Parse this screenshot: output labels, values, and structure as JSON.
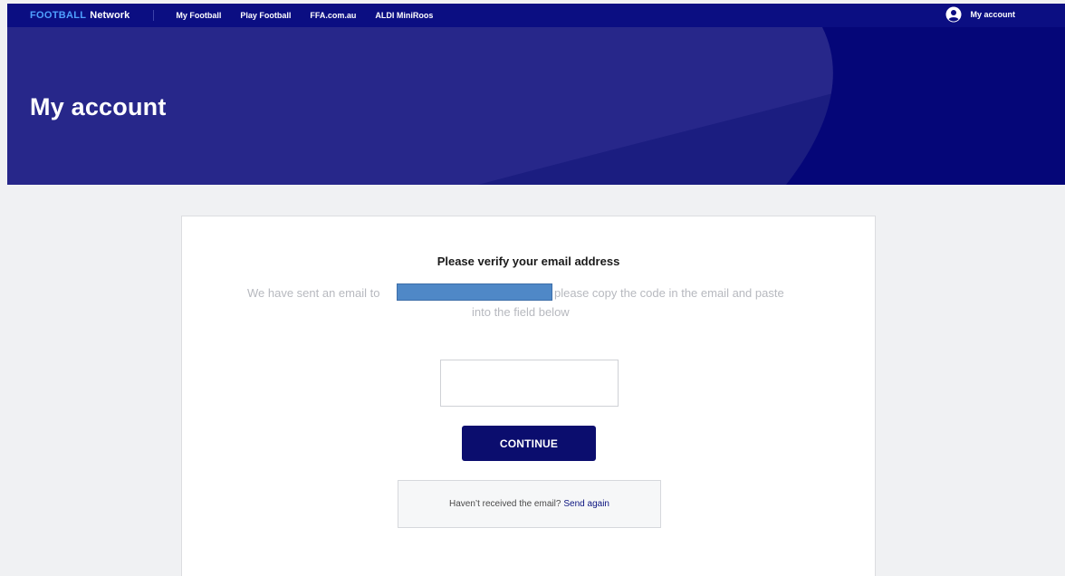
{
  "colors": {
    "nav_bg": "#0b0e82",
    "hero_bg": "#27278a",
    "brand_accent": "#4fa0ff",
    "button_bg": "#0b0d6e",
    "page_bg": "#f0f1f3",
    "redaction": "#4f88c7"
  },
  "nav": {
    "brand_primary": "FOOTBALL",
    "brand_secondary": "Network",
    "links": [
      {
        "label": "My Football"
      },
      {
        "label": "Play Football"
      },
      {
        "label": "FFA.com.au"
      },
      {
        "label": "ALDI MiniRoos"
      }
    ],
    "account": {
      "label": "My account",
      "icon": "user-circle-icon"
    }
  },
  "hero": {
    "title": "My account"
  },
  "verify": {
    "heading": "Please verify your email address",
    "message_before": "We have sent an email to",
    "message_after": "please copy the code in the email and paste",
    "message_line2": "into the field below",
    "code_value": "",
    "code_placeholder": "",
    "continue_label": "CONTINUE",
    "resend_text": "Haven’t received the email?",
    "resend_link": "Send again"
  }
}
